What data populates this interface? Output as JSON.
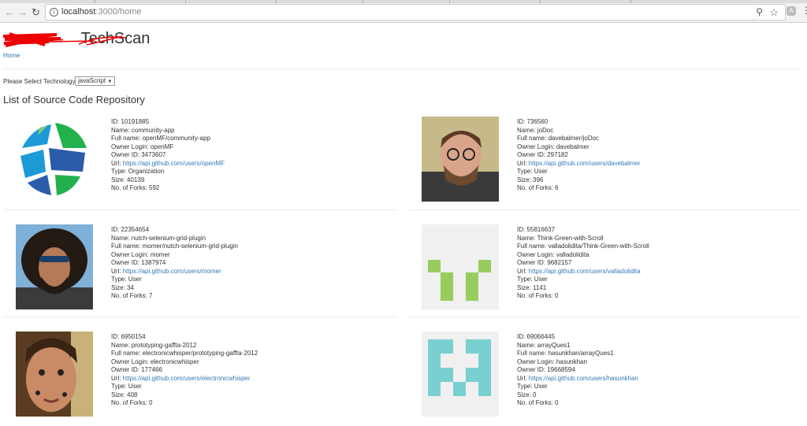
{
  "browser": {
    "url_host": "localhost",
    "url_rest": ":3000/home",
    "back_icon": "arrow-left-icon",
    "forward_icon": "arrow-right-icon",
    "reload_icon": "reload-icon"
  },
  "header": {
    "brand": "TechScan",
    "breadcrumb": "Home"
  },
  "filter": {
    "label": "Please Select Technology:",
    "selected": "javaScript"
  },
  "heading": "List of Source Code Repository",
  "labels": {
    "id": "ID: ",
    "name": "Name: ",
    "full_name": "Full name: ",
    "owner_login": "Owner Login: ",
    "owner_id": "Owner ID: ",
    "url": "Url: ",
    "type": "Type: ",
    "size": "Size: ",
    "forks": "No. of Forks: "
  },
  "repos": [
    {
      "id": "10191885",
      "name": "community-app",
      "full_name": "openMF/community-app",
      "owner_login": "openMF",
      "owner_id": "3473607",
      "url": "https://api.github.com/users/openMF",
      "type": "Organization",
      "size": "40139",
      "forks": "592"
    },
    {
      "id": "736560",
      "name": "joDoc",
      "full_name": "davebalmer/joDoc",
      "owner_login": "davebalmer",
      "owner_id": "297182",
      "url": "https://api.github.com/users/davebalmer",
      "type": "User",
      "size": "396",
      "forks": "6"
    },
    {
      "id": "22354654",
      "name": "nutch-selenium-grid-plugin",
      "full_name": "momer/nutch-selenium-grid-plugin",
      "owner_login": "momer",
      "owner_id": "1387974",
      "url": "https://api.github.com/users/momer",
      "type": "User",
      "size": "34",
      "forks": "7"
    },
    {
      "id": "55816637",
      "name": "Think-Green-with-Scroll",
      "full_name": "valladolidita/Think-Green-with-Scroll",
      "owner_login": "valladolidita",
      "owner_id": "9682157",
      "url": "https://api.github.com/users/valladolidita",
      "type": "User",
      "size": "1141",
      "forks": "0"
    },
    {
      "id": "6950154",
      "name": "prototyping-gaffta-2012",
      "full_name": "electronicwhisper/prototyping-gaffta-2012",
      "owner_login": "electronicwhisper",
      "owner_id": "177466",
      "url": "https://api.github.com/users/electronicwhisper",
      "type": "User",
      "size": "408",
      "forks": "0"
    },
    {
      "id": "69066445",
      "name": "arrayQues1",
      "full_name": "hasunkhan/arrayQues1",
      "owner_login": "hasunkhan",
      "owner_id": "19668594",
      "url": "https://api.github.com/users/hasunkhan",
      "type": "User",
      "size": "0",
      "forks": "0"
    }
  ],
  "colors": {
    "link": "#337ab7",
    "identicon_green": "#99cc5f",
    "identicon_cyan": "#7acfd0"
  }
}
